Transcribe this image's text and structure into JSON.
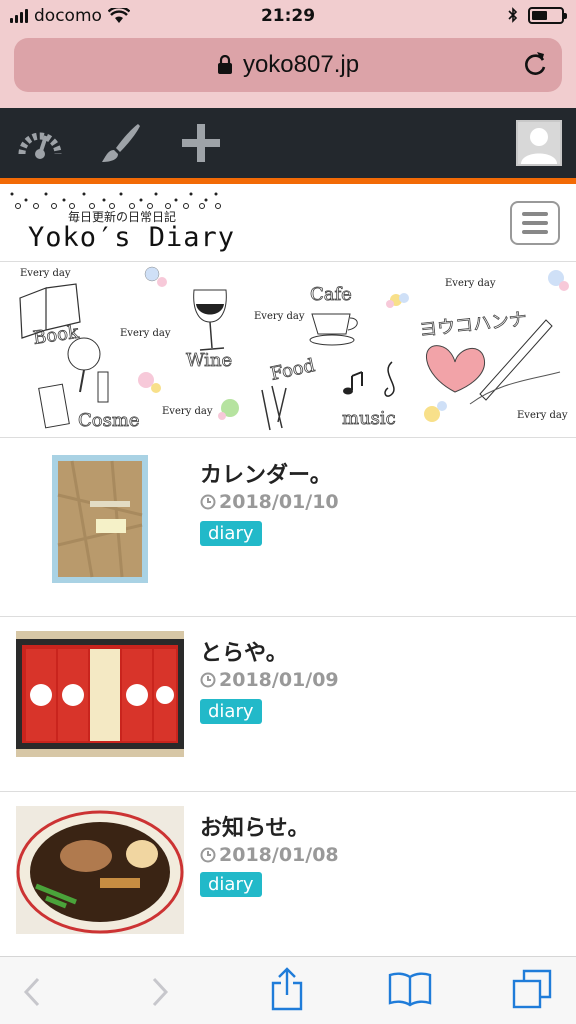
{
  "status_bar": {
    "carrier": "docomo",
    "time": "21:29",
    "battery_level": 0.55
  },
  "browser": {
    "url": "yoko807.jp"
  },
  "admin_bar": {
    "icons": [
      "dashboard-icon",
      "customize-brush-icon",
      "add-new-icon",
      "user-avatar"
    ]
  },
  "site": {
    "tagline": "毎日更新の日常日記",
    "title": "Yoko′s Diary"
  },
  "banner": {
    "labels": [
      "Every day",
      "Every day",
      "Every day",
      "Every day",
      "Every day",
      "Every day"
    ],
    "words": [
      "Book",
      "Wine",
      "Cafe",
      "Food",
      "Cosme",
      "music",
      "ヨウコハンナ"
    ]
  },
  "posts": [
    {
      "title": "カレンダー。",
      "date": "2018/01/10",
      "category": "diary"
    },
    {
      "title": "とらや。",
      "date": "2018/01/09",
      "category": "diary"
    },
    {
      "title": "お知らせ。",
      "date": "2018/01/08",
      "category": "diary"
    }
  ],
  "colors": {
    "status_bg": "#f1cdcf",
    "url_bg": "#dca3a8",
    "admin_bg": "#23282d",
    "accent_orange": "#f26a06",
    "tag_bg": "#22b9c9",
    "ios_blue": "#1f7cd9"
  }
}
